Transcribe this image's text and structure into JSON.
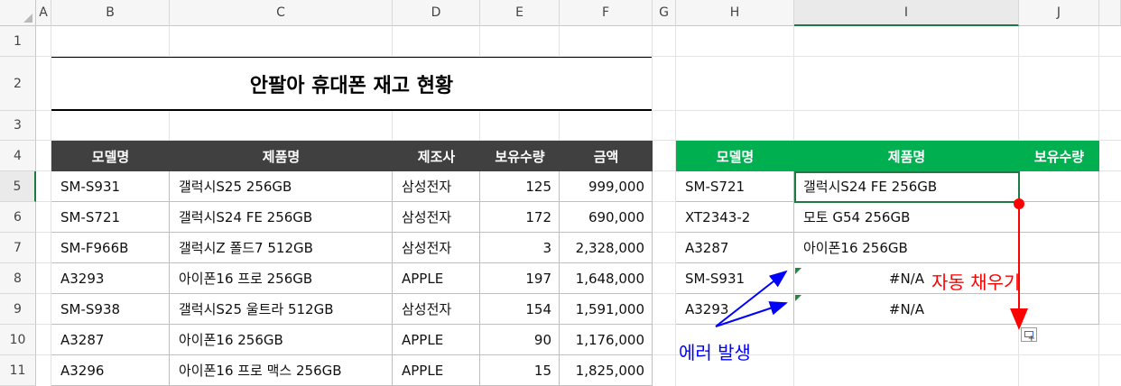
{
  "columns": [
    "A",
    "B",
    "C",
    "D",
    "E",
    "F",
    "G",
    "H",
    "I",
    "J"
  ],
  "rows": [
    "1",
    "2",
    "3",
    "4",
    "5",
    "6",
    "7",
    "8",
    "9",
    "10",
    "11"
  ],
  "title": "안팔아 휴대폰 재고 현황",
  "inventory": {
    "headers": [
      "모델명",
      "제품명",
      "제조사",
      "보유수량",
      "금액"
    ],
    "rows": [
      [
        "SM-S931",
        "갤럭시S25 256GB",
        "삼성전자",
        "125",
        "999,000"
      ],
      [
        "SM-S721",
        "갤럭시S24 FE 256GB",
        "삼성전자",
        "172",
        "690,000"
      ],
      [
        "SM-F966B",
        "갤럭시Z 폴드7 512GB",
        "삼성전자",
        "3",
        "2,328,000"
      ],
      [
        "A3293",
        "아이폰16 프로 256GB",
        "APPLE",
        "197",
        "1,648,000"
      ],
      [
        "SM-S938",
        "갤럭시S25 울트라 512GB",
        "삼성전자",
        "154",
        "1,591,000"
      ],
      [
        "A3287",
        "아이폰16 256GB",
        "APPLE",
        "90",
        "1,176,000"
      ],
      [
        "A3296",
        "아이폰16 프로 맥스 256GB",
        "APPLE",
        "15",
        "1,825,000"
      ]
    ]
  },
  "lookup": {
    "headers": [
      "모델명",
      "제품명",
      "보유수량"
    ],
    "rows": [
      [
        "SM-S721",
        "갤럭시S24 FE 256GB"
      ],
      [
        "XT2343-2",
        "모토 G54 256GB"
      ],
      [
        "A3287",
        "아이폰16 256GB"
      ],
      [
        "SM-S931",
        "#N/A"
      ],
      [
        "A3293",
        "#N/A"
      ]
    ]
  },
  "annotations": {
    "autofill": "자동 채우기",
    "error": "에러 발생"
  },
  "colors": {
    "header_dark": "#404040",
    "header_green": "#00b050",
    "selection": "#1e7a45",
    "annotation_red": "#ff0000",
    "annotation_blue": "#0000ff"
  }
}
